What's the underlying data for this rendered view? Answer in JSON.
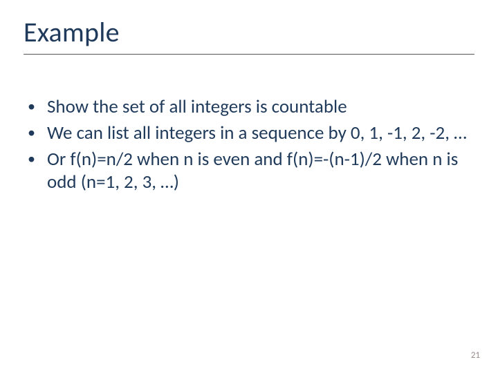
{
  "title": "Example",
  "bullets": [
    "Show the set of all integers is countable",
    "We can list all integers in a sequence by 0, 1, -1, 2, -2, …",
    "Or f(n)=n/2 when n is even and f(n)=-(n-1)/2 when n is odd (n=1, 2, 3, …)"
  ],
  "page_number": "21"
}
